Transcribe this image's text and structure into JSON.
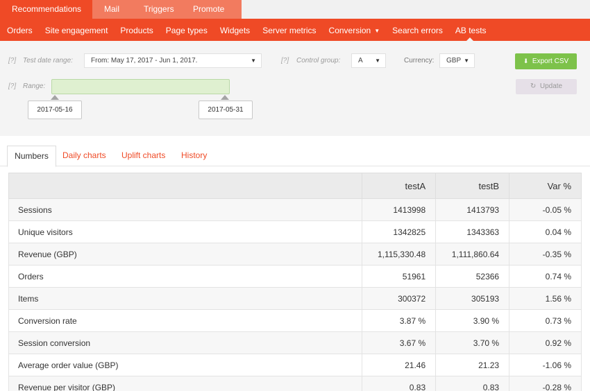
{
  "top_tabs": [
    "Recommendations",
    "Mail",
    "Triggers",
    "Promote"
  ],
  "sub_nav": [
    "Orders",
    "Site engagement",
    "Products",
    "Page types",
    "Widgets",
    "Server metrics",
    "Conversion",
    "Search errors",
    "AB tests"
  ],
  "filter": {
    "help": "[?]",
    "test_date_range_label": "Test date range:",
    "date_range_value": "From: May 17, 2017 - Jun 1, 2017.",
    "control_group_label": "Control group:",
    "control_group_value": "A",
    "currency_label": "Currency:",
    "currency_value": "GBP",
    "range_label": "Range:",
    "range_start": "2017-05-16",
    "range_end": "2017-05-31",
    "export_label": "Export CSV",
    "update_label": "Update"
  },
  "tabs": [
    "Numbers",
    "Daily charts",
    "Uplift charts",
    "History"
  ],
  "table": {
    "headers": [
      "",
      "testA",
      "testB",
      "Var %"
    ],
    "rows": [
      [
        "Sessions",
        "1413998",
        "1413793",
        "-0.05 %"
      ],
      [
        "Unique visitors",
        "1342825",
        "1343363",
        "0.04 %"
      ],
      [
        "Revenue (GBP)",
        "1,115,330.48",
        "1,111,860.64",
        "-0.35 %"
      ],
      [
        "Orders",
        "51961",
        "52366",
        "0.74 %"
      ],
      [
        "Items",
        "300372",
        "305193",
        "1.56 %"
      ],
      [
        "Conversion rate",
        "3.87 %",
        "3.90 %",
        "0.73 %"
      ],
      [
        "Session conversion",
        "3.67 %",
        "3.70 %",
        "0.92 %"
      ],
      [
        "Average order value (GBP)",
        "21.46",
        "21.23",
        "-1.06 %"
      ],
      [
        "Revenue per visitor (GBP)",
        "0.83",
        "0.83",
        "-0.28 %"
      ]
    ]
  },
  "colors": {
    "brand_orange": "#ef4a26",
    "export_green": "#7dc24a"
  }
}
